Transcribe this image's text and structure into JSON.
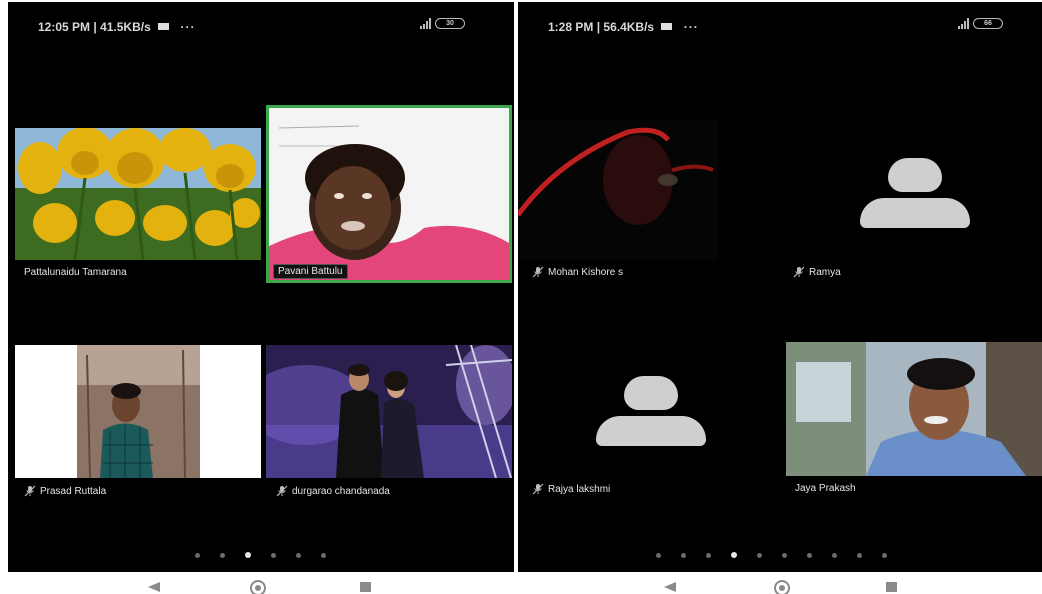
{
  "left_screen": {
    "status": {
      "time": "12:05 PM",
      "speed": "41.5KB/s",
      "overflow": "···",
      "battery": "30"
    },
    "participants": [
      {
        "name": "Pattalunaidu Tamarana",
        "video": "tulips",
        "muted": false,
        "active": false
      },
      {
        "name": "Pavani Battulu",
        "video": "woman-pink",
        "muted": false,
        "active": true
      },
      {
        "name": "Prasad Ruttala",
        "video": "man-checkered",
        "muted": true,
        "active": false
      },
      {
        "name": "durgarao chandanada",
        "video": "couple-stage",
        "muted": true,
        "active": false
      }
    ],
    "pager": {
      "pages": 6,
      "current": 3
    }
  },
  "right_screen": {
    "status": {
      "time": "1:28 PM",
      "speed": "56.4KB/s",
      "overflow": "···",
      "battery": "66"
    },
    "participants": [
      {
        "name": "Mohan Kishore s",
        "video": "dark-helmet",
        "muted": true
      },
      {
        "name": "Ramya",
        "video": "avatar-placeholder",
        "muted": true
      },
      {
        "name": "Rajya lakshmi",
        "video": "avatar-placeholder",
        "muted": true
      },
      {
        "name": "Jaya Prakash",
        "video": "man-selfie",
        "muted": false
      }
    ],
    "pager": {
      "pages": 10,
      "current": 4
    }
  },
  "icons": {
    "mic_muted": "mic-off-icon",
    "back": "back-triangle-icon",
    "home": "home-circle-icon",
    "recents": "recents-square-icon",
    "message": "message-icon",
    "signal": "signal-icon",
    "battery": "battery-icon"
  },
  "colors": {
    "active_border": "#3aa84a",
    "background": "#000000"
  }
}
